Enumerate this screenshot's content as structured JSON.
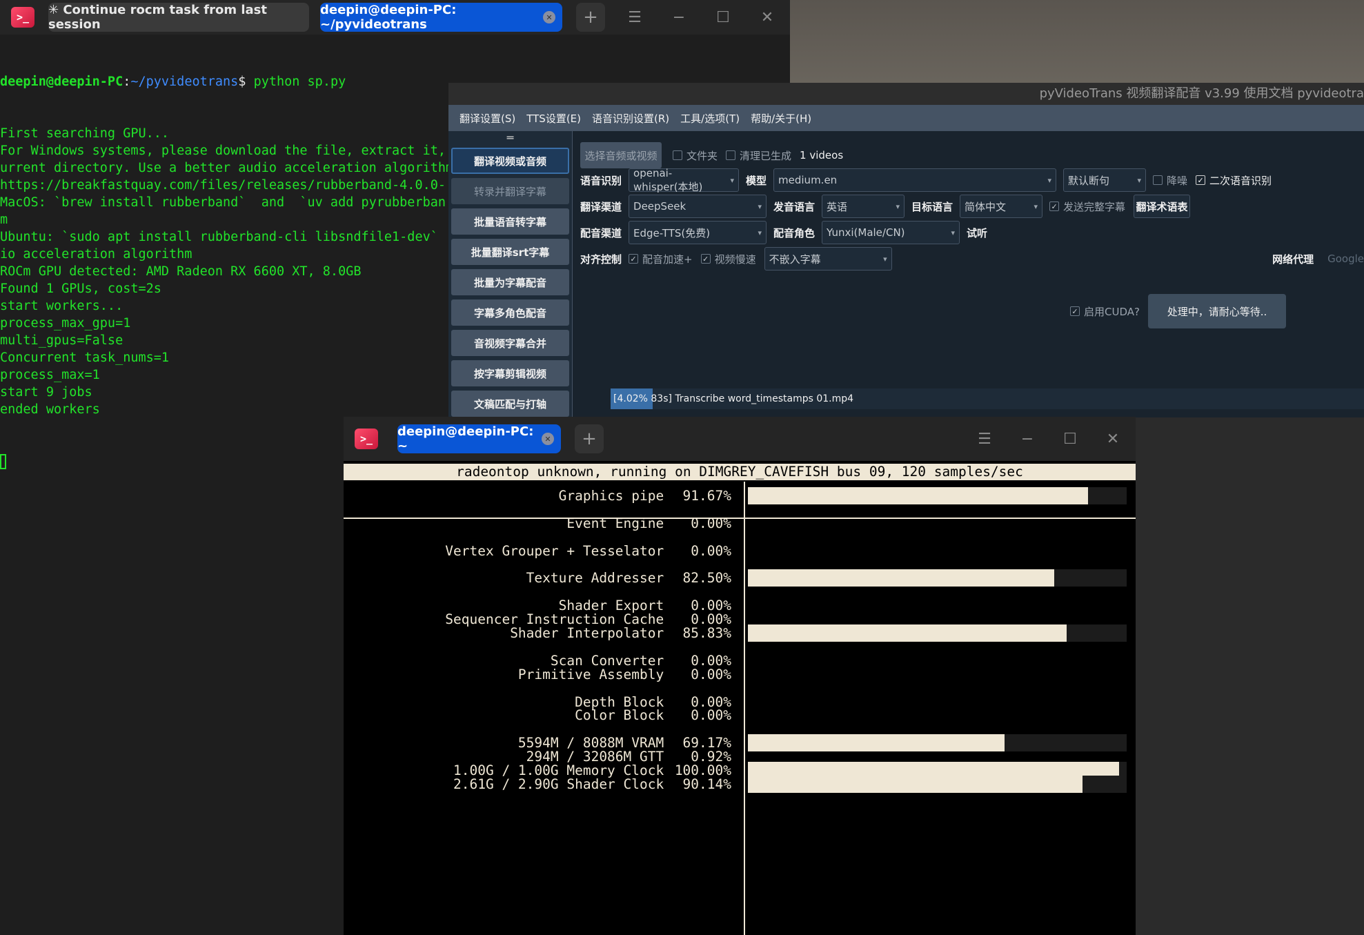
{
  "term1": {
    "tabs": [
      "✳ Continue rocm task from last session",
      "deepin@deepin-PC: ~/pyvideotrans"
    ],
    "prompt": {
      "user": "deepin@deepin-PC",
      "sep": ":",
      "path": "~/pyvideotrans",
      "sym": "$",
      "cmd": " python sp.py"
    },
    "lines": [
      "First searching GPU...",
      "For Windows systems, please download the file, extract it, and place it in the ffmpeg folder in the c",
      "urrent directory. Use a better audio acceleration algorithm",
      "https://breakfastquay.com/files/releases/rubberband-4.0.0-",
      "MacOS: `brew install rubberband`  and  `uv add pyrubberban",
      "m",
      "Ubuntu: `sudo apt install rubberband-cli libsndfile1-dev`",
      "io acceleration algorithm",
      "ROCm GPU detected: AMD Radeon RX 6600 XT, 8.0GB",
      "Found 1 GPUs, cost=2s",
      "start workers...",
      "process_max_gpu=1",
      "multi_gpus=False",
      "Concurrent task_nums=1",
      "process_max=1",
      "start 9 jobs",
      "ended workers"
    ]
  },
  "pvt": {
    "title": "pyVideoTrans 视频翻译配音 v3.99 使用文档 pyvideotra",
    "menu": [
      "翻译设置(S)",
      "TTS设置(E)",
      "语音识别设置(R)",
      "工具/选项(T)",
      "帮助/关于(H)"
    ],
    "side": [
      "翻译视频或音频",
      "转录并翻译字幕",
      "批量语音转字幕",
      "批量翻译srt字幕",
      "批量为字幕配音",
      "字幕多角色配音",
      "音视频字幕合并",
      "按字幕剪辑视频",
      "文稿匹配与打轴"
    ],
    "select_btn": "选择音频或视频",
    "folder": "文件夹",
    "clear": "清理已生成",
    "count": "1 videos",
    "asr_label": "语音识别",
    "asr_value": "openai-whisper(本地)",
    "model_label": "模型",
    "model_value": "medium.en",
    "split_value": "默认断句",
    "denoise": "降噪",
    "second_asr": "二次语音识别",
    "trans_label": "翻译渠道",
    "trans_value": "DeepSeek",
    "src_label": "发音语言",
    "src_value": "英语",
    "tgt_label": "目标语言",
    "tgt_value": "简体中文",
    "send_full": "发送完整字幕",
    "glossary": "翻译术语表",
    "dub_label": "配音渠道",
    "dub_value": "Edge-TTS(免费)",
    "role_label": "配音角色",
    "role_value": "Yunxi(Male/CN)",
    "listen": "试听",
    "align_label": "对齐控制",
    "dub_speed": "配音加速+",
    "video_slow": "视频慢速",
    "embed_value": "不嵌入字幕",
    "proxy_label": "网络代理",
    "proxy_value": "Google",
    "cuda": "启用CUDA?",
    "process_btn": "处理中，请耐心等待..",
    "progress_text": "[4.02%  83s]  Transcribe word_timestamps 01.mp4",
    "progress": 0.0402
  },
  "term2": {
    "tab": "deepin@deepin-PC: ~",
    "header": "radeontop unknown, running on DIMGREY_CAVEFISH bus 09, 120 samples/sec",
    "rows": [
      {
        "label": "Graphics pipe",
        "value": "91.67%",
        "fill": 0.9167,
        "row": 0
      },
      {
        "label": "Event Engine",
        "value": "0.00%",
        "fill": 0,
        "row": 2
      },
      {
        "label": "Vertex Grouper + Tesselator",
        "value": "0.00%",
        "fill": 0,
        "row": 4
      },
      {
        "label": "Texture Addresser",
        "value": "82.50%",
        "fill": 0.825,
        "row": 6
      },
      {
        "label": "Shader Export",
        "value": "0.00%",
        "fill": 0,
        "row": 8
      },
      {
        "label": "Sequencer Instruction Cache",
        "value": "0.00%",
        "fill": 0,
        "row": 9
      },
      {
        "label": "Shader Interpolator",
        "value": "85.83%",
        "fill": 0.8583,
        "row": 10
      },
      {
        "label": "Scan Converter",
        "value": "0.00%",
        "fill": 0,
        "row": 12
      },
      {
        "label": "Primitive Assembly",
        "value": "0.00%",
        "fill": 0,
        "row": 13
      },
      {
        "label": "Depth Block",
        "value": "0.00%",
        "fill": 0,
        "row": 15
      },
      {
        "label": "Color Block",
        "value": "0.00%",
        "fill": 0,
        "row": 16
      },
      {
        "label": "5594M / 8088M VRAM",
        "value": "69.17%",
        "fill": 0.6917,
        "row": 18
      },
      {
        "label": "294M / 32086M GTT",
        "value": "0.92%",
        "fill": 0.0092,
        "row": 19
      },
      {
        "label": "1.00G / 1.00G Memory Clock",
        "value": "100.00%",
        "fill": 1.0,
        "row": 20
      },
      {
        "label": "2.61G / 2.90G Shader Clock",
        "value": "90.14%",
        "fill": 0.9014,
        "row": 21
      }
    ]
  }
}
